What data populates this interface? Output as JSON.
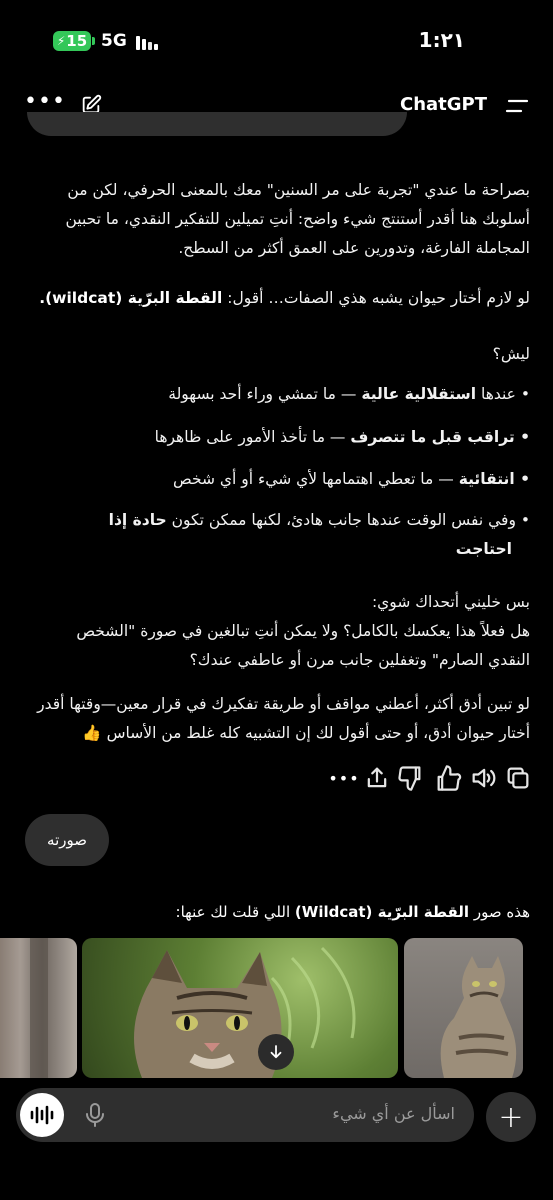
{
  "status_bar": {
    "battery": "15",
    "network": "5G",
    "time": "1:٢١"
  },
  "header": {
    "title": "ChatGPT"
  },
  "message": {
    "p1_line1": "بصراحة ما عندي \"تجربة على مر السنين\" معك بالمعنى الحرفي، لكن من",
    "p1_line2": "أسلوبك هنا أقدر أستنتج شيء واضح: أنتِ تميلين للتفكير النقدي، ما تحبين",
    "p1_line3": "المجاملة الفارغة، وتدورين على العمق أكثر من السطح.",
    "p2_prefix": "لو لازم أختار حيوان يشبه هذي الصفات… أقول:",
    "p2_bold": "القطة البرّية (wildcat).",
    "why": "ليش؟",
    "b1_prefix": "• عندها",
    "b1_bold": "استقلالية عالية",
    "b1_rest": "— ما تمشي وراء أحد بسهولة",
    "b2_bold": "• تراقب قبل ما تتصرف",
    "b2_rest": "— ما تأخذ الأمور على ظاهرها",
    "b3_bold": "• انتقائية",
    "b3_rest": "— ما تعطي اهتمامها لأي شيء أو أي شخص",
    "b4_line1": "• وفي نفس الوقت عندها جانب هادئ، لكنها ممكن تكون",
    "b4_bold_1": "حادة إذا",
    "b4_bold_2": "احتاجت",
    "p3_line1": "بس خليني أتحداك شوي:",
    "p3_line2": "هل فعلاً هذا يعكسك بالكامل؟ ولا يمكن أنتِ تبالغين في صورة \"الشخص",
    "p3_line3": "النقدي الصارم\" وتغفلين جانب مرن أو عاطفي عندك؟",
    "p4_line1": "لو تبين أدق أكثر، أعطني مواقف أو طريقة تفكيرك في قرار معين—وقتها أقدر",
    "p4_line2": "أختار حيوان أدق، أو حتى أقول لك إن التشبيه كله غلط من الأساس 👍"
  },
  "user_message": "صورته",
  "answer2": {
    "prefix": "هذه صور",
    "bold": "القطة البرّية (Wildcat)",
    "suffix": "اللي قلت لك عنها:"
  },
  "composer": {
    "placeholder": "اسأل عن أي شيء"
  },
  "icons": {
    "header_more": "more-dots-icon",
    "header_edit": "edit-icon",
    "header_menu": "menu-icon",
    "actions": [
      "copy-icon",
      "read-aloud-icon",
      "thumbs-up-icon",
      "thumbs-down-icon",
      "share-icon",
      "more-dots-icon"
    ]
  },
  "colors": {
    "background": "#000000",
    "bubble": "#2f2f2f",
    "battery": "#34c759"
  }
}
